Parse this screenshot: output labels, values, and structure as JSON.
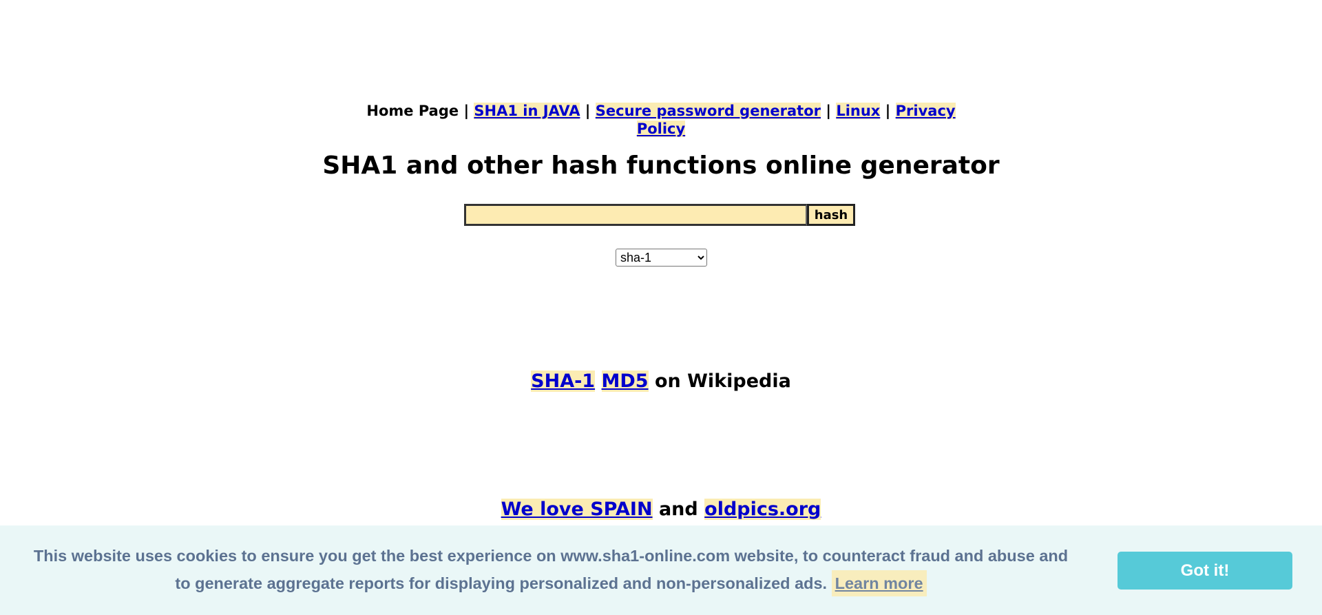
{
  "nav": {
    "home": "Home Page",
    "separator": "|",
    "links": [
      {
        "label": "SHA1 in JAVA"
      },
      {
        "label": "Secure password generator"
      },
      {
        "label": "Linux"
      },
      {
        "label": "Privacy Policy"
      }
    ]
  },
  "title": "SHA1 and other hash functions online generator",
  "hash_form": {
    "input_value": "",
    "button_label": "hash",
    "algorithm_selected": "sha-1"
  },
  "wikipedia": {
    "link_sha1": "SHA-1",
    "link_md5": "MD5",
    "suffix": "on Wikipedia"
  },
  "promo": {
    "link_spain": "We love SPAIN",
    "connector": "and",
    "link_oldpics": "oldpics.org"
  },
  "cookie_banner": {
    "message": "This website uses cookies to ensure you get the best experience on www.sha1-online.com website, to counteract fraud and abuse and to generate aggregate reports for displaying personalized and non-personalized ads.",
    "learn_more": "Learn more",
    "accept_label": "Got it!"
  },
  "colors": {
    "link": "#0000cc",
    "highlight": "#fbecb3",
    "cookie_bg": "#eaf7f7",
    "cookie_text": "#5c7291",
    "accept_button": "#56cad8"
  }
}
